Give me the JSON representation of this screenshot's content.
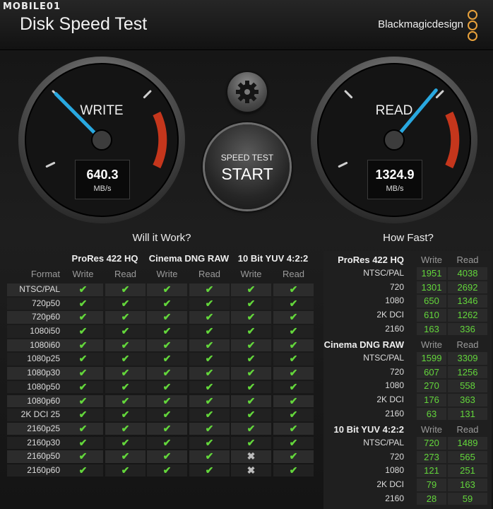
{
  "watermark": "MOBILE01",
  "app": {
    "title": "Disk Speed Test",
    "brand": "Blackmagicdesign"
  },
  "colors": {
    "accent": "#29a8e0",
    "ok": "#63d63b",
    "warn": "#d63a1e",
    "logo": "#e9a23c"
  },
  "write_gauge": {
    "label": "WRITE",
    "value": "640.3",
    "unit": "MB/s",
    "needle_fraction": 0.31
  },
  "read_gauge": {
    "label": "READ",
    "value": "1324.9",
    "unit": "MB/s",
    "needle_fraction": 0.67
  },
  "settings_icon": "gear-icon",
  "start_button": {
    "line1": "SPEED TEST",
    "line2": "START"
  },
  "will_it_work": {
    "heading": "Will it Work?",
    "format_label": "Format",
    "groups": [
      "ProRes 422 HQ",
      "Cinema DNG RAW",
      "10 Bit YUV 4:2:2"
    ],
    "sub_labels": [
      "Write",
      "Read",
      "Write",
      "Read",
      "Write",
      "Read"
    ],
    "ok_symbol": "✔",
    "no_symbol": "✖",
    "rows": [
      {
        "format": "NTSC/PAL",
        "checks": [
          true,
          true,
          true,
          true,
          true,
          true
        ]
      },
      {
        "format": "720p50",
        "checks": [
          true,
          true,
          true,
          true,
          true,
          true
        ]
      },
      {
        "format": "720p60",
        "checks": [
          true,
          true,
          true,
          true,
          true,
          true
        ]
      },
      {
        "format": "1080i50",
        "checks": [
          true,
          true,
          true,
          true,
          true,
          true
        ]
      },
      {
        "format": "1080i60",
        "checks": [
          true,
          true,
          true,
          true,
          true,
          true
        ]
      },
      {
        "format": "1080p25",
        "checks": [
          true,
          true,
          true,
          true,
          true,
          true
        ]
      },
      {
        "format": "1080p30",
        "checks": [
          true,
          true,
          true,
          true,
          true,
          true
        ]
      },
      {
        "format": "1080p50",
        "checks": [
          true,
          true,
          true,
          true,
          true,
          true
        ]
      },
      {
        "format": "1080p60",
        "checks": [
          true,
          true,
          true,
          true,
          true,
          true
        ]
      },
      {
        "format": "2K DCI 25",
        "checks": [
          true,
          true,
          true,
          true,
          true,
          true
        ]
      },
      {
        "format": "2160p25",
        "checks": [
          true,
          true,
          true,
          true,
          true,
          true
        ]
      },
      {
        "format": "2160p30",
        "checks": [
          true,
          true,
          true,
          true,
          true,
          true
        ]
      },
      {
        "format": "2160p50",
        "checks": [
          true,
          true,
          true,
          true,
          false,
          true
        ]
      },
      {
        "format": "2160p60",
        "checks": [
          true,
          true,
          true,
          true,
          false,
          true
        ]
      }
    ]
  },
  "how_fast": {
    "heading": "How Fast?",
    "col_write": "Write",
    "col_read": "Read",
    "groups": [
      {
        "title": "ProRes 422 HQ",
        "rows": [
          {
            "label": "NTSC/PAL",
            "write": "1951",
            "read": "4038"
          },
          {
            "label": "720",
            "write": "1301",
            "read": "2692"
          },
          {
            "label": "1080",
            "write": "650",
            "read": "1346"
          },
          {
            "label": "2K DCI",
            "write": "610",
            "read": "1262"
          },
          {
            "label": "2160",
            "write": "163",
            "read": "336"
          }
        ]
      },
      {
        "title": "Cinema DNG RAW",
        "rows": [
          {
            "label": "NTSC/PAL",
            "write": "1599",
            "read": "3309"
          },
          {
            "label": "720",
            "write": "607",
            "read": "1256"
          },
          {
            "label": "1080",
            "write": "270",
            "read": "558"
          },
          {
            "label": "2K DCI",
            "write": "176",
            "read": "363"
          },
          {
            "label": "2160",
            "write": "63",
            "read": "131"
          }
        ]
      },
      {
        "title": "10 Bit YUV 4:2:2",
        "rows": [
          {
            "label": "NTSC/PAL",
            "write": "720",
            "read": "1489"
          },
          {
            "label": "720",
            "write": "273",
            "read": "565"
          },
          {
            "label": "1080",
            "write": "121",
            "read": "251"
          },
          {
            "label": "2K DCI",
            "write": "79",
            "read": "163"
          },
          {
            "label": "2160",
            "write": "28",
            "read": "59"
          }
        ]
      }
    ]
  }
}
